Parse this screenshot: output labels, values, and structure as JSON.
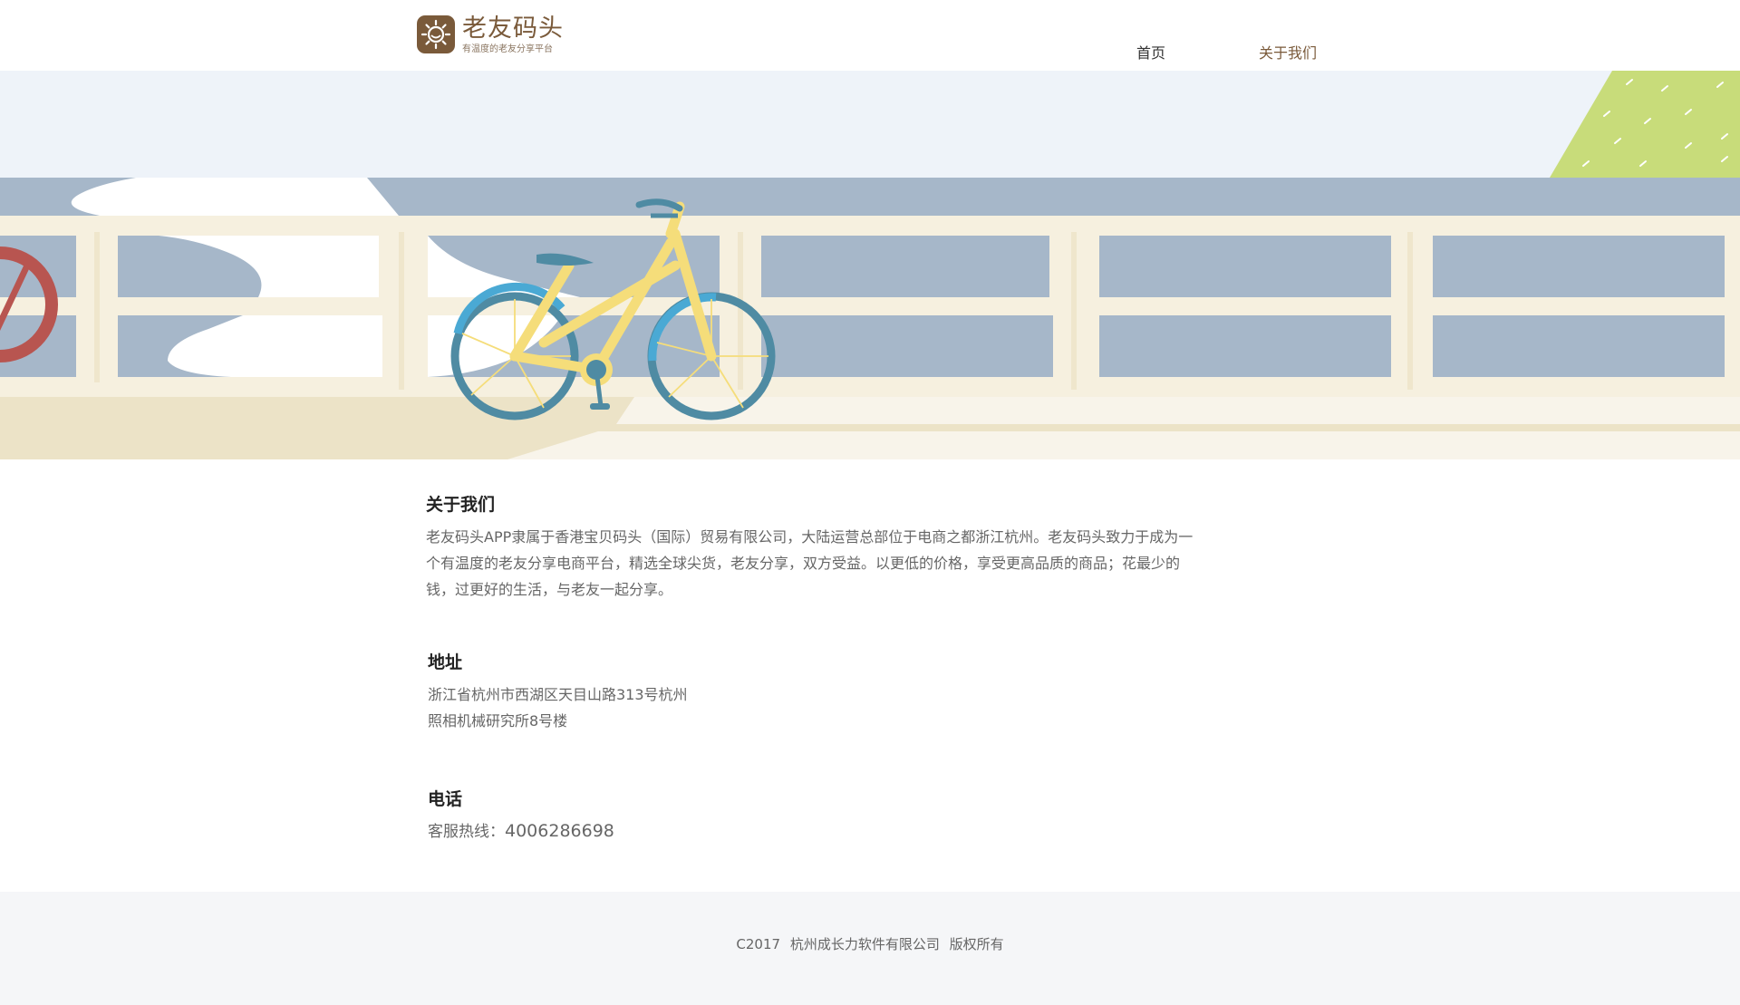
{
  "header": {
    "logo_name": "老友码头",
    "logo_slogan": "有温度的老友分享平台",
    "nav": [
      {
        "label": "首页",
        "active": false
      },
      {
        "label": "关于我们",
        "active": true
      }
    ]
  },
  "about": {
    "title": "关于我们",
    "text": "老友码头APP隶属于香港宝贝码头（国际）贸易有限公司，大陆运营总部位于电商之都浙江杭州。老友码头致力于成为一个有温度的老友分享电商平台，精选全球尖货，老友分享，双方受益。以更低的价格，享受更高品质的商品；花最少的钱，过更好的生活，与老友一起分享。"
  },
  "address": {
    "title": "地址",
    "line1": "浙江省杭州市西湖区天目山路313号杭州",
    "line2": "照相机械研究所8号楼"
  },
  "phone": {
    "title": "电话",
    "label": "客服热线：",
    "number": "4006286698"
  },
  "footer": {
    "copyright": "C2017  杭州成长力软件有限公司   版权所有"
  },
  "colors": {
    "brand": "#7a5a3a",
    "sky": "#eef3f9",
    "water": "#a6b7c9",
    "railing": "#f6f0df",
    "bike_frame": "#f5dd7a",
    "bike_wheel": "#4f8ba3",
    "grass": "#c8dc7a",
    "buoy": "#b85550"
  }
}
